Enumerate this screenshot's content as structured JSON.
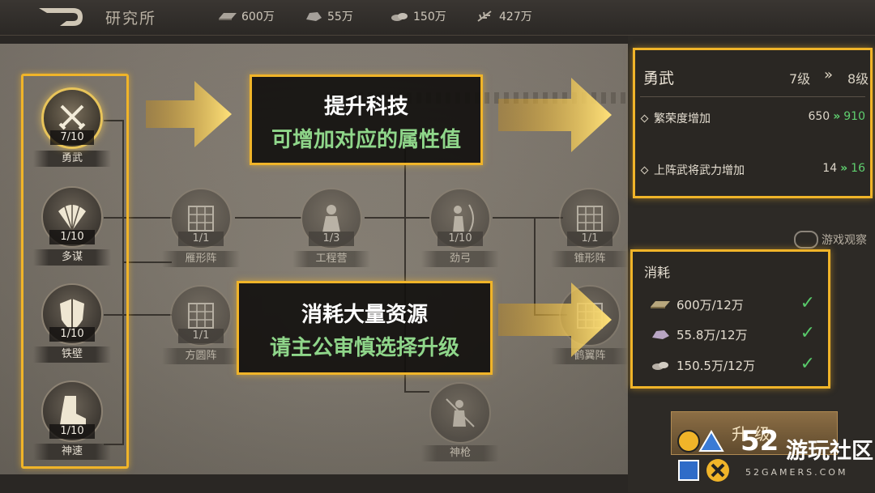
{
  "header": {
    "title": "研究所",
    "resources": [
      {
        "icon": "silver-ingot-icon",
        "value": "600万"
      },
      {
        "icon": "iron-ore-icon",
        "value": "55万"
      },
      {
        "icon": "stone-icon",
        "value": "150万"
      },
      {
        "icon": "grain-icon",
        "value": "427万"
      }
    ]
  },
  "tree": {
    "column": [
      {
        "level": "7/10",
        "name": "勇武",
        "icon": "crossed-swords-icon"
      },
      {
        "level": "1/10",
        "name": "多谋",
        "icon": "fan-icon"
      },
      {
        "level": "1/10",
        "name": "铁壁",
        "icon": "shield-icon"
      },
      {
        "level": "1/10",
        "name": "神速",
        "icon": "boot-icon"
      }
    ],
    "nodes": [
      {
        "level": "1/1",
        "name": "雁形阵",
        "icon": "formation-grid-icon"
      },
      {
        "level": "1/3",
        "name": "工程营",
        "icon": "engineer-icon"
      },
      {
        "level": "1/10",
        "name": "劲弓",
        "icon": "archer-icon"
      },
      {
        "level": "1/1",
        "name": "锥形阵",
        "icon": "formation-grid-icon"
      },
      {
        "level": "1/1",
        "name": "方圆阵",
        "icon": "formation-grid-icon"
      },
      {
        "level": "",
        "name": "鹤翼阵",
        "icon": "formation-grid-icon"
      },
      {
        "level": "",
        "name": "神枪",
        "icon": "spearman-icon"
      }
    ]
  },
  "callouts": {
    "top": {
      "line1": "提升科技",
      "line2": "可增加对应的属性值"
    },
    "bottom": {
      "line1": "消耗大量资源",
      "line2": "请主公审慎选择升级"
    }
  },
  "detail": {
    "name": "勇武",
    "level_from": "7级",
    "level_to": "8级",
    "stats": [
      {
        "label": "繁荣度增加",
        "from": "650",
        "to": "910"
      },
      {
        "label": "上阵武将武力增加",
        "from": "14",
        "to": "16"
      }
    ]
  },
  "cost": {
    "title": "消耗",
    "rows": [
      {
        "icon": "silver-ingot-icon",
        "text": "600万/12万"
      },
      {
        "icon": "iron-ore-icon",
        "text": "55.8万/12万"
      },
      {
        "icon": "stone-icon",
        "text": "150.5万/12万"
      }
    ]
  },
  "upgrade_label": "升级",
  "watermark": "游戏观察",
  "brand": {
    "number": "52",
    "name": "游玩社区",
    "domain": "52GAMERS.COM"
  },
  "colors": {
    "highlight": "#f0b429",
    "increase": "#5fcf6f",
    "accent_text": "#8fd68a"
  }
}
